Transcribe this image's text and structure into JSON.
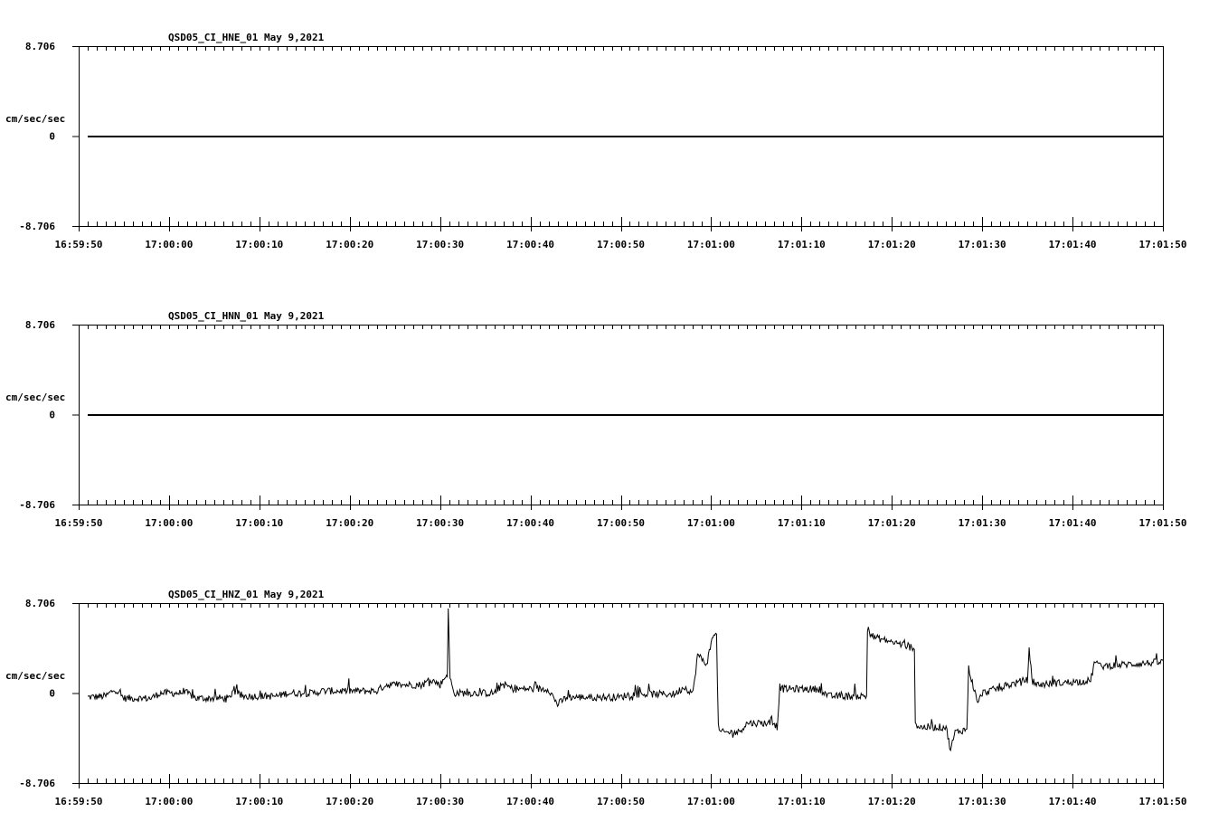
{
  "chart_data": [
    {
      "type": "line",
      "title": "QSD05_CI_HNE_01  May 9,2021",
      "ylabel": "cm/sec/sec",
      "ylim": [
        -8.706,
        8.706
      ],
      "ytick_labels": [
        "8.706",
        "0",
        "-8.706"
      ],
      "xlim_seconds": [
        0,
        120
      ],
      "xtick_labels": [
        "16:59:50",
        "17:00:00",
        "17:00:10",
        "17:00:20",
        "17:00:30",
        "17:00:40",
        "17:00:50",
        "17:01:00",
        "17:01:10",
        "17:01:20",
        "17:01:30",
        "17:01:40",
        "17:01:50"
      ],
      "trace": {
        "t": [
          1,
          120
        ],
        "v": [
          0,
          0
        ]
      },
      "noise": 0.0
    },
    {
      "type": "line",
      "title": "QSD05_CI_HNN_01  May 9,2021",
      "ylabel": "cm/sec/sec",
      "ylim": [
        -8.706,
        8.706
      ],
      "ytick_labels": [
        "8.706",
        "0",
        "-8.706"
      ],
      "xlim_seconds": [
        0,
        120
      ],
      "xtick_labels": [
        "16:59:50",
        "17:00:00",
        "17:00:10",
        "17:00:20",
        "17:00:30",
        "17:00:40",
        "17:00:50",
        "17:01:00",
        "17:01:10",
        "17:01:20",
        "17:01:30",
        "17:01:40",
        "17:01:50"
      ],
      "trace": {
        "t": [
          1,
          120
        ],
        "v": [
          0,
          0
        ]
      },
      "noise": 0.0
    },
    {
      "type": "line",
      "title": "QSD05_CI_HNZ_01  May 9,2021",
      "ylabel": "cm/sec/sec",
      "ylim": [
        -8.706,
        8.706
      ],
      "ytick_labels": [
        "8.706",
        "0",
        "-8.706"
      ],
      "xlim_seconds": [
        0,
        120
      ],
      "xtick_labels": [
        "16:59:50",
        "17:00:00",
        "17:00:10",
        "17:00:20",
        "17:00:30",
        "17:00:40",
        "17:00:50",
        "17:01:00",
        "17:01:10",
        "17:01:20",
        "17:01:30",
        "17:01:40",
        "17:01:50"
      ],
      "trace": {
        "t": [
          1,
          3,
          4,
          5,
          8,
          9,
          12,
          13,
          16.8,
          17,
          18,
          22,
          23,
          26,
          27,
          33,
          34,
          38,
          39,
          40,
          40.8,
          40.9,
          41.1,
          41.5,
          46,
          47,
          48,
          52,
          53,
          54,
          60,
          61,
          66,
          67,
          68,
          68.5,
          69.5,
          70.3,
          70.6,
          70.8,
          71,
          73,
          74,
          77,
          77.3,
          77.6,
          78,
          82,
          83,
          87.2,
          87.3,
          88,
          92,
          92.5,
          92.6,
          93,
          96,
          96.5,
          97,
          98.3,
          98.5,
          99.5,
          100,
          105,
          105.2,
          105.5,
          106,
          112,
          112.5,
          113,
          120
        ],
        "v": [
          -0.4,
          -0.3,
          0.4,
          -0.5,
          -0.5,
          0,
          0,
          -0.5,
          -0.5,
          0.3,
          -0.3,
          -0.3,
          0,
          0,
          0.2,
          0.2,
          0.8,
          0.8,
          1.3,
          0.8,
          1.9,
          7.9,
          1.5,
          0,
          0,
          0.9,
          0.4,
          0.4,
          -1.1,
          -0.4,
          -0.4,
          -0.1,
          -0.1,
          0.6,
          0,
          3.7,
          2.8,
          5.9,
          5.5,
          -3.3,
          -3.8,
          -3.8,
          -2.9,
          -2.9,
          -3.3,
          0.6,
          0.4,
          0.4,
          -0.3,
          -0.3,
          6.1,
          5.4,
          4.5,
          4.4,
          -2.9,
          -3.3,
          -3.3,
          -5.5,
          -3.8,
          -3.5,
          2.4,
          -1.0,
          0,
          1.3,
          4.1,
          1.5,
          0.8,
          1.2,
          3.2,
          2.6,
          3.0
        ]
      },
      "noise": 0.35
    }
  ]
}
